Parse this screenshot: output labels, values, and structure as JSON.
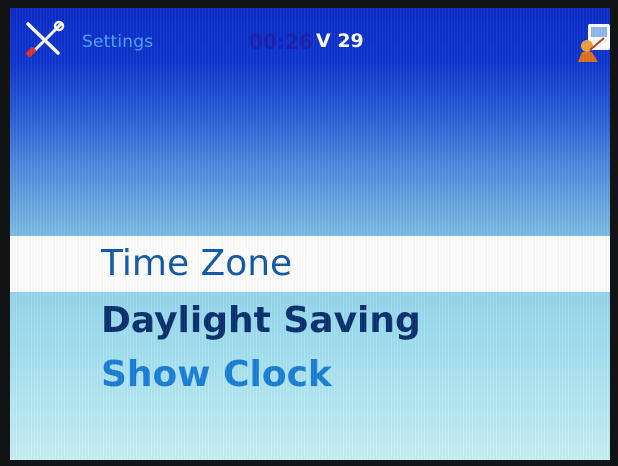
{
  "header": {
    "icon": "tools-icon",
    "title": "Settings",
    "time": "00:26",
    "volume": "V 29",
    "corner_icon": "presenter-icon"
  },
  "menu": {
    "items": [
      {
        "label": "Time Zone",
        "selected": true
      },
      {
        "label": "Daylight Saving",
        "selected": false
      },
      {
        "label": "Show Clock",
        "selected": false
      }
    ]
  },
  "colors": {
    "top_blue": "#0a2bc9",
    "bottom_cyan": "#c9f0f6",
    "selection": "#ffffff",
    "selected_text": "#1158a8",
    "daylight_text": "#08306e",
    "clock_text": "#1a7fd6"
  }
}
